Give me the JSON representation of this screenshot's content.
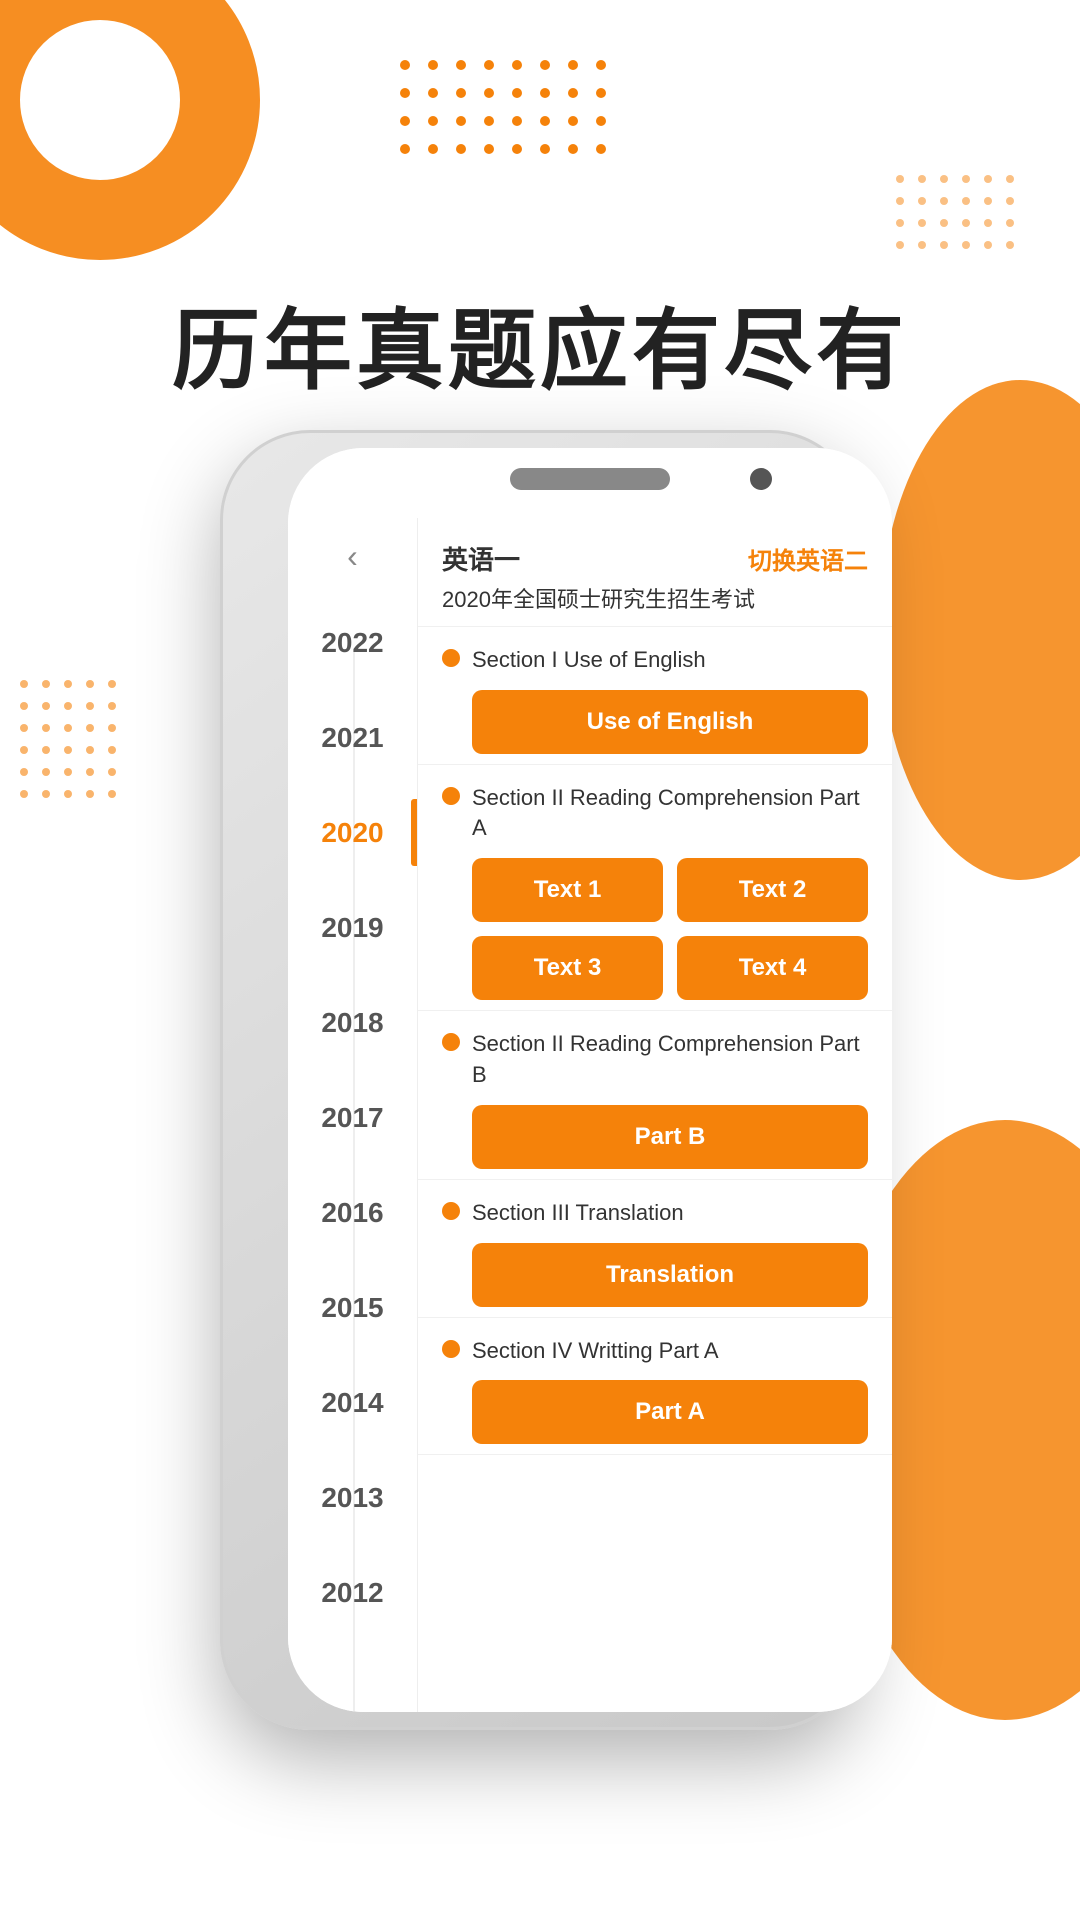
{
  "hero": {
    "title": "历年真题应有尽有"
  },
  "phone": {
    "header": {
      "lang_label": "英语一",
      "lang_switch": "切换英语二",
      "exam_title": "2020年全国硕士研究生招生考试"
    },
    "years": [
      {
        "year": "2022",
        "active": false
      },
      {
        "year": "2021",
        "active": false
      },
      {
        "year": "2020",
        "active": true
      },
      {
        "year": "2019",
        "active": false
      },
      {
        "year": "2018",
        "active": false
      },
      {
        "year": "2017",
        "active": false
      },
      {
        "year": "2016",
        "active": false
      },
      {
        "year": "2015",
        "active": false
      },
      {
        "year": "2014",
        "active": false
      },
      {
        "year": "2013",
        "active": false
      },
      {
        "year": "2012",
        "active": false
      }
    ],
    "sections": [
      {
        "title": "Section I Use of English",
        "buttons": [
          {
            "label": "Use of English"
          }
        ],
        "grid": 1
      },
      {
        "title": "Section II Reading Comprehension Part A",
        "buttons": [
          {
            "label": "Text 1"
          },
          {
            "label": "Text 2"
          },
          {
            "label": "Text 3"
          },
          {
            "label": "Text 4"
          }
        ],
        "grid": 2
      },
      {
        "title": "Section II Reading Comprehension Part B",
        "buttons": [
          {
            "label": "Part B"
          }
        ],
        "grid": 1
      },
      {
        "title": "Section III Translation",
        "buttons": [
          {
            "label": "Translation"
          }
        ],
        "grid": 1
      },
      {
        "title": "Section IV Writting Part A",
        "buttons": [
          {
            "label": "Part A"
          }
        ],
        "grid": 1
      }
    ]
  },
  "back_label": "‹",
  "colors": {
    "orange": "#F5820A",
    "dark": "#222222",
    "mid": "#555555",
    "light": "#888888"
  }
}
